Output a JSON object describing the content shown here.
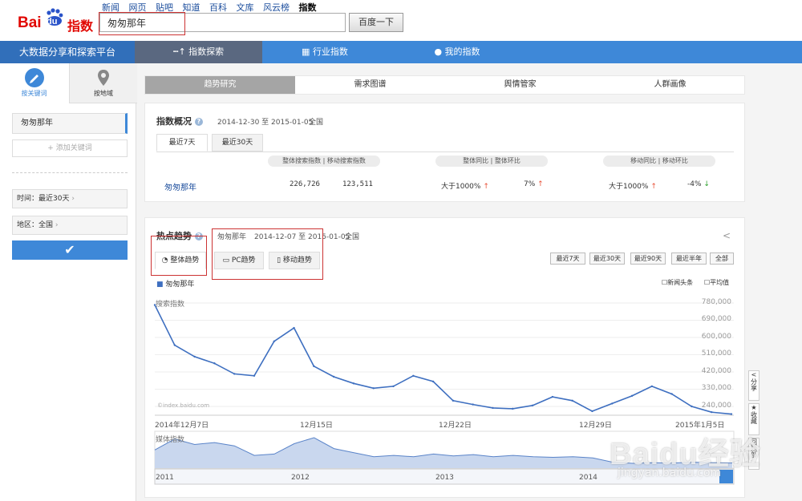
{
  "header": {
    "logo_bai": "Bai",
    "logo_du": "du",
    "logo_zhishu": "指数",
    "links": [
      "新闻",
      "网页",
      "贴吧",
      "知道",
      "百科",
      "文库",
      "风云榜",
      "指数"
    ],
    "search_value": "匆匆那年",
    "search_button": "百度一下"
  },
  "nav": {
    "brand": "大数据分享和探索平台",
    "items": [
      "指数探索",
      "行业指数",
      "我的指数"
    ],
    "active": 0
  },
  "sidebar": {
    "tabs": [
      "按关键词",
      "按地域"
    ],
    "keyword": "匆匆那年",
    "add_keyword": "添加关键词",
    "time_label": "时间：最近30天",
    "region_label": "地区：全国",
    "confirm": "✔"
  },
  "main_tabs": [
    "趋势研究",
    "需求图谱",
    "舆情管家",
    "人群画像"
  ],
  "overview": {
    "title": "指数概况",
    "date_range": "2014-12-30 至 2015-01-05",
    "region": "全国",
    "tabs": [
      "最近7天",
      "最近30天"
    ],
    "col_headers": [
      "整体搜索指数",
      "移动搜索指数",
      "整体同比",
      "整体环比",
      "移动同比",
      "移动环比"
    ],
    "row": {
      "keyword": "匆匆那年",
      "overall_index": "226,726",
      "mobile_index": "123,511",
      "overall_yoy": "大于1000%",
      "overall_mom": "7%",
      "mobile_yoy": "大于1000%",
      "mobile_mom": "-4%"
    }
  },
  "trend": {
    "title": "热点趋势",
    "keyword": "匆匆那年",
    "date_range": "2014-12-07 至 2015-01-05",
    "region": "全国",
    "tabs": [
      "整体趋势",
      "PC趋势",
      "移动趋势"
    ],
    "range_buttons": [
      "最近7天",
      "最近30天",
      "最近90天",
      "最近半年",
      "全部"
    ],
    "legend": "匆匆那年",
    "checkbox_news": "新闻头条",
    "checkbox_avg": "平均值",
    "y_label": "搜索指数",
    "source": "©index.baidu.com",
    "mini_label": "媒体指数",
    "side_buttons": [
      "分享",
      "收藏",
      "回顶部"
    ]
  },
  "chart_data": {
    "type": "line",
    "ylabel": "搜索指数",
    "ylim": [
      240000,
      780000
    ],
    "y_ticks": [
      "780,000",
      "690,000",
      "600,000",
      "510,000",
      "420,000",
      "330,000",
      "240,000"
    ],
    "x_ticks": [
      "2014年12月7日",
      "12月15日",
      "12月22日",
      "12月29日",
      "2015年1月5日"
    ],
    "series": [
      {
        "name": "匆匆那年",
        "values": [
          770000,
          560000,
          500000,
          465000,
          410000,
          400000,
          580000,
          650000,
          450000,
          395000,
          360000,
          335000,
          345000,
          400000,
          370000,
          270000,
          250000,
          232000,
          228000,
          245000,
          290000,
          270000,
          215000,
          255000,
          295000,
          345000,
          305000,
          240000,
          210000,
          200000
        ]
      }
    ],
    "overview_x_ticks": [
      "2011",
      "2012",
      "2013",
      "2014"
    ],
    "grid": true,
    "legend_position": "top-left"
  }
}
